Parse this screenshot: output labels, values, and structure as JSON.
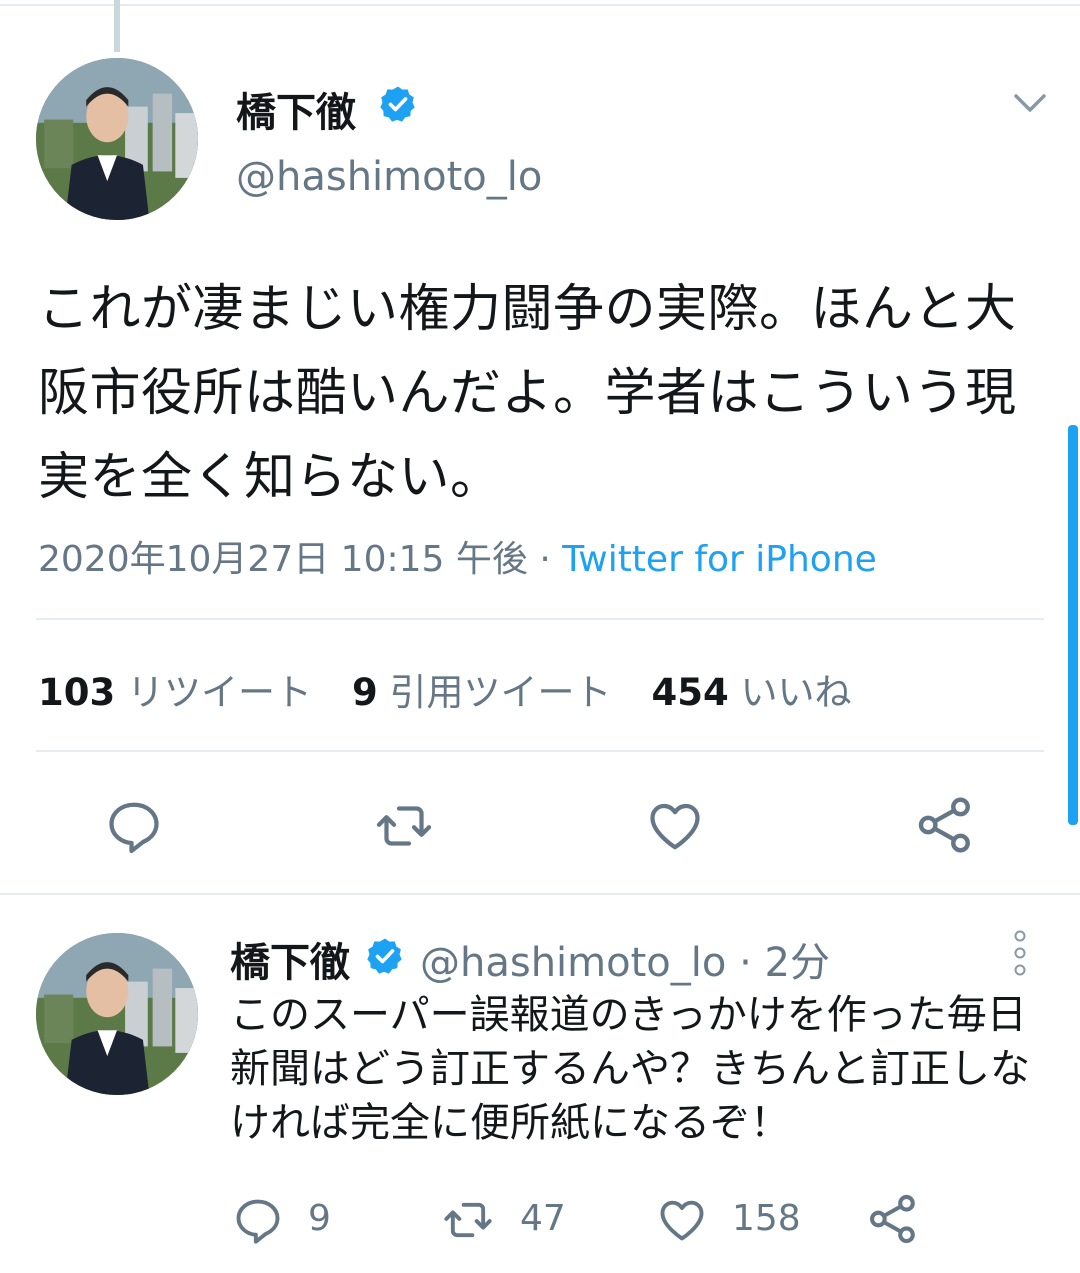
{
  "main_tweet": {
    "display_name": "橋下徹",
    "handle": "@hashimoto_lo",
    "text": "これが凄まじい権力闘争の実際。ほんと大阪市役所は酷いんだよ。学者はこういう現実を全く知らない。",
    "timestamp": "2020年10月27日 10:15 午後",
    "separator": " · ",
    "source": "Twitter for iPhone",
    "stats": {
      "retweets_count": "103",
      "retweets_label": "リツイート",
      "quotes_count": "9",
      "quotes_label": "引用ツイート",
      "likes_count": "454",
      "likes_label": "いいね"
    }
  },
  "reply_tweet": {
    "display_name": "橋下徹",
    "handle_time": "@hashimoto_lo · 2分",
    "text": "このスーパー誤報道のきっかけを作った毎日新聞はどう訂正するんや？きちんと訂正しなければ完全に便所紙になるぞ！",
    "counts": {
      "replies": "9",
      "retweets": "47",
      "likes": "158"
    }
  },
  "icons": {
    "verified": "verified-badge-icon",
    "chevron": "chevron-down-icon",
    "reply": "reply-icon",
    "retweet": "retweet-icon",
    "like": "heart-icon",
    "share": "share-icon",
    "more": "more-vertical-icon"
  },
  "colors": {
    "accent": "#1da1f2",
    "secondary_text": "#657786",
    "divider": "#e6ecf0"
  }
}
